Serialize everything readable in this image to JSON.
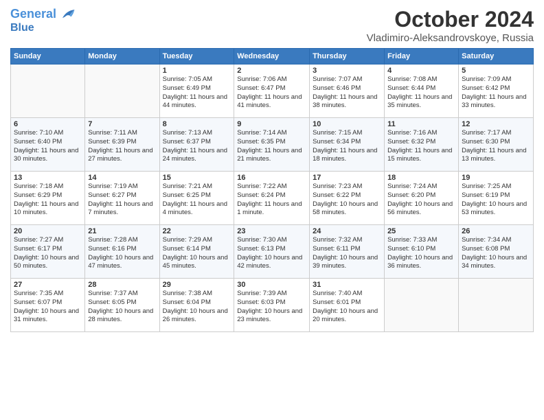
{
  "header": {
    "logo_line1": "General",
    "logo_line2": "Blue",
    "month": "October 2024",
    "location": "Vladimiro-Aleksandrovskoye, Russia"
  },
  "weekdays": [
    "Sunday",
    "Monday",
    "Tuesday",
    "Wednesday",
    "Thursday",
    "Friday",
    "Saturday"
  ],
  "weeks": [
    [
      {
        "day": "",
        "info": ""
      },
      {
        "day": "",
        "info": ""
      },
      {
        "day": "1",
        "info": "Sunrise: 7:05 AM\nSunset: 6:49 PM\nDaylight: 11 hours and 44 minutes."
      },
      {
        "day": "2",
        "info": "Sunrise: 7:06 AM\nSunset: 6:47 PM\nDaylight: 11 hours and 41 minutes."
      },
      {
        "day": "3",
        "info": "Sunrise: 7:07 AM\nSunset: 6:46 PM\nDaylight: 11 hours and 38 minutes."
      },
      {
        "day": "4",
        "info": "Sunrise: 7:08 AM\nSunset: 6:44 PM\nDaylight: 11 hours and 35 minutes."
      },
      {
        "day": "5",
        "info": "Sunrise: 7:09 AM\nSunset: 6:42 PM\nDaylight: 11 hours and 33 minutes."
      }
    ],
    [
      {
        "day": "6",
        "info": "Sunrise: 7:10 AM\nSunset: 6:40 PM\nDaylight: 11 hours and 30 minutes."
      },
      {
        "day": "7",
        "info": "Sunrise: 7:11 AM\nSunset: 6:39 PM\nDaylight: 11 hours and 27 minutes."
      },
      {
        "day": "8",
        "info": "Sunrise: 7:13 AM\nSunset: 6:37 PM\nDaylight: 11 hours and 24 minutes."
      },
      {
        "day": "9",
        "info": "Sunrise: 7:14 AM\nSunset: 6:35 PM\nDaylight: 11 hours and 21 minutes."
      },
      {
        "day": "10",
        "info": "Sunrise: 7:15 AM\nSunset: 6:34 PM\nDaylight: 11 hours and 18 minutes."
      },
      {
        "day": "11",
        "info": "Sunrise: 7:16 AM\nSunset: 6:32 PM\nDaylight: 11 hours and 15 minutes."
      },
      {
        "day": "12",
        "info": "Sunrise: 7:17 AM\nSunset: 6:30 PM\nDaylight: 11 hours and 13 minutes."
      }
    ],
    [
      {
        "day": "13",
        "info": "Sunrise: 7:18 AM\nSunset: 6:29 PM\nDaylight: 11 hours and 10 minutes."
      },
      {
        "day": "14",
        "info": "Sunrise: 7:19 AM\nSunset: 6:27 PM\nDaylight: 11 hours and 7 minutes."
      },
      {
        "day": "15",
        "info": "Sunrise: 7:21 AM\nSunset: 6:25 PM\nDaylight: 11 hours and 4 minutes."
      },
      {
        "day": "16",
        "info": "Sunrise: 7:22 AM\nSunset: 6:24 PM\nDaylight: 11 hours and 1 minute."
      },
      {
        "day": "17",
        "info": "Sunrise: 7:23 AM\nSunset: 6:22 PM\nDaylight: 10 hours and 58 minutes."
      },
      {
        "day": "18",
        "info": "Sunrise: 7:24 AM\nSunset: 6:20 PM\nDaylight: 10 hours and 56 minutes."
      },
      {
        "day": "19",
        "info": "Sunrise: 7:25 AM\nSunset: 6:19 PM\nDaylight: 10 hours and 53 minutes."
      }
    ],
    [
      {
        "day": "20",
        "info": "Sunrise: 7:27 AM\nSunset: 6:17 PM\nDaylight: 10 hours and 50 minutes."
      },
      {
        "day": "21",
        "info": "Sunrise: 7:28 AM\nSunset: 6:16 PM\nDaylight: 10 hours and 47 minutes."
      },
      {
        "day": "22",
        "info": "Sunrise: 7:29 AM\nSunset: 6:14 PM\nDaylight: 10 hours and 45 minutes."
      },
      {
        "day": "23",
        "info": "Sunrise: 7:30 AM\nSunset: 6:13 PM\nDaylight: 10 hours and 42 minutes."
      },
      {
        "day": "24",
        "info": "Sunrise: 7:32 AM\nSunset: 6:11 PM\nDaylight: 10 hours and 39 minutes."
      },
      {
        "day": "25",
        "info": "Sunrise: 7:33 AM\nSunset: 6:10 PM\nDaylight: 10 hours and 36 minutes."
      },
      {
        "day": "26",
        "info": "Sunrise: 7:34 AM\nSunset: 6:08 PM\nDaylight: 10 hours and 34 minutes."
      }
    ],
    [
      {
        "day": "27",
        "info": "Sunrise: 7:35 AM\nSunset: 6:07 PM\nDaylight: 10 hours and 31 minutes."
      },
      {
        "day": "28",
        "info": "Sunrise: 7:37 AM\nSunset: 6:05 PM\nDaylight: 10 hours and 28 minutes."
      },
      {
        "day": "29",
        "info": "Sunrise: 7:38 AM\nSunset: 6:04 PM\nDaylight: 10 hours and 26 minutes."
      },
      {
        "day": "30",
        "info": "Sunrise: 7:39 AM\nSunset: 6:03 PM\nDaylight: 10 hours and 23 minutes."
      },
      {
        "day": "31",
        "info": "Sunrise: 7:40 AM\nSunset: 6:01 PM\nDaylight: 10 hours and 20 minutes."
      },
      {
        "day": "",
        "info": ""
      },
      {
        "day": "",
        "info": ""
      }
    ]
  ]
}
